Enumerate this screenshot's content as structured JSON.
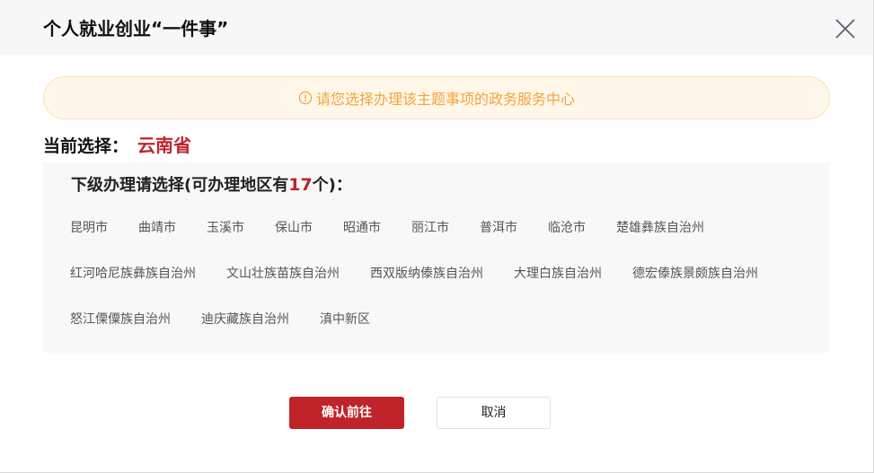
{
  "dialog": {
    "title": "个人就业创业“一件事”"
  },
  "notice": {
    "text": "请您选择办理该主题事项的政务服务中心",
    "icon": "info-circle-icon",
    "color": "#f5a33c"
  },
  "current": {
    "label": "当前选择：",
    "value": "云南省"
  },
  "panel": {
    "title_prefix": "下级办理请选择(可办理地区有",
    "count": "17",
    "title_suffix": "个)：",
    "rows": [
      [
        "昆明市",
        "曲靖市",
        "玉溪市",
        "保山市",
        "昭通市",
        "丽江市",
        "普洱市",
        "临沧市",
        "楚雄彝族自治州"
      ],
      [
        "红河哈尼族彝族自治州",
        "文山壮族苗族自治州",
        "西双版纳傣族自治州",
        "大理白族自治州",
        "德宏傣族景颇族自治州"
      ],
      [
        "怒江傈僳族自治州",
        "迪庆藏族自治州",
        "滇中新区"
      ]
    ]
  },
  "buttons": {
    "confirm": "确认前往",
    "cancel": "取消"
  },
  "colors": {
    "accent": "#c0232a",
    "notice_bg": "#fff7ea",
    "panel_bg": "#f8f8f9"
  }
}
